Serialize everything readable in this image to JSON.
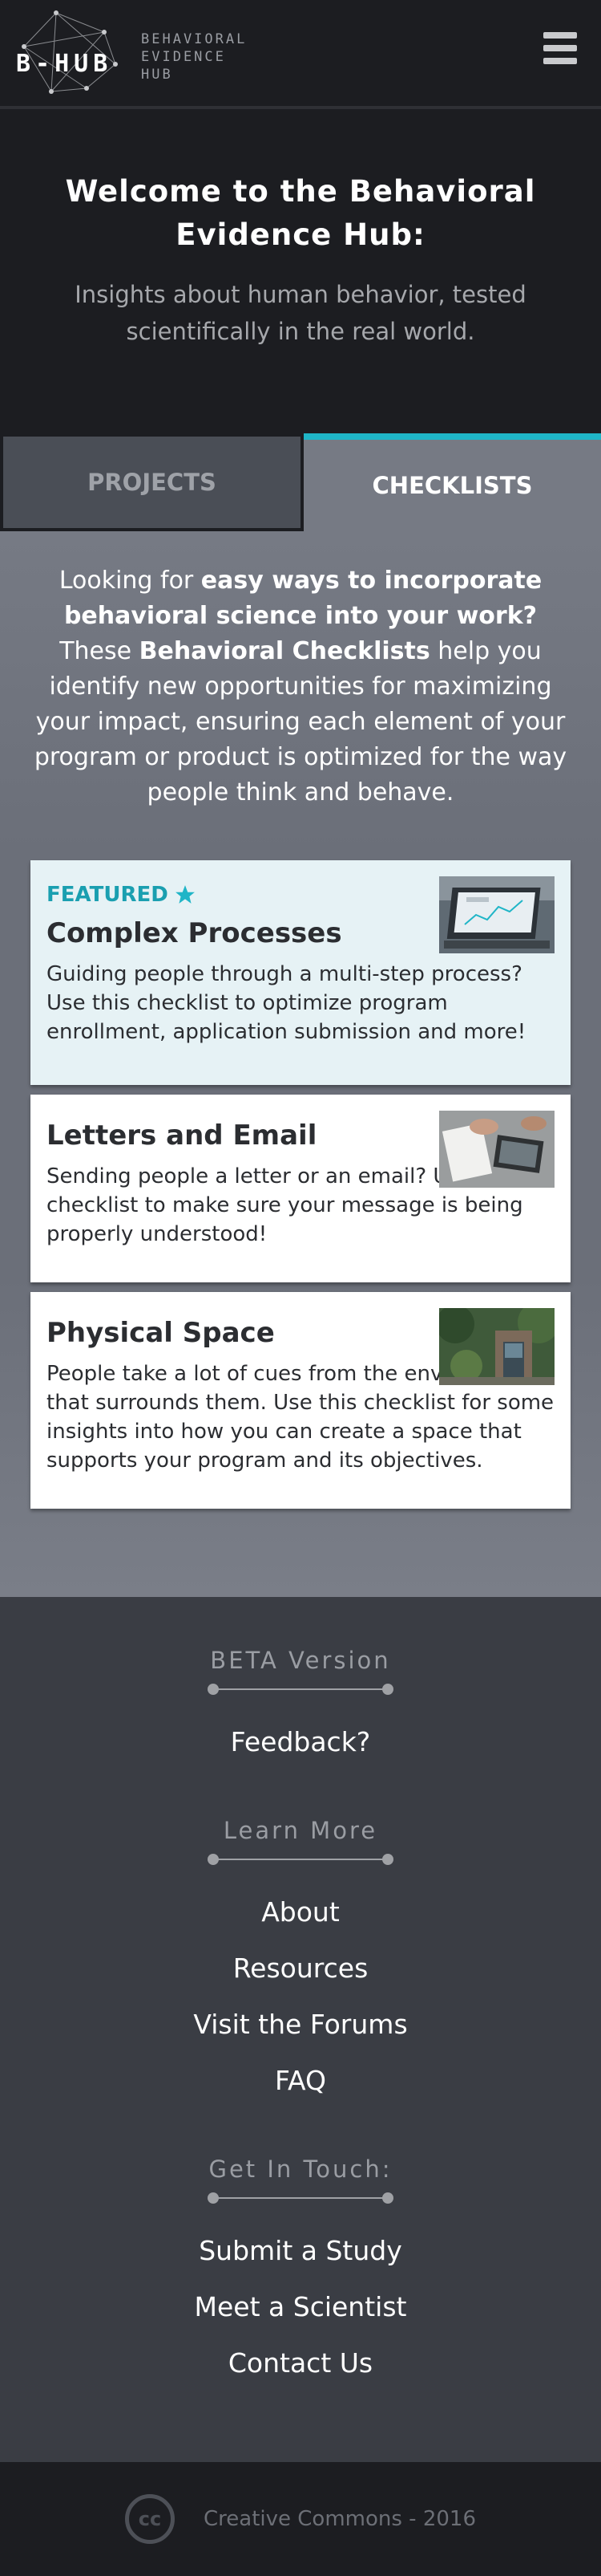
{
  "header": {
    "logo_text": "B-HUB",
    "logo_sub": [
      "BEHAVIORAL",
      "EVIDENCE",
      "HUB"
    ],
    "menu_icon": "hamburger-icon"
  },
  "hero": {
    "title": "Welcome to the Behavioral Evidence Hub:",
    "subtitle": "Insights about human behavior, tested scientifically in the real world."
  },
  "tabs": [
    {
      "label": "PROJECTS",
      "active": false
    },
    {
      "label": "CHECKLISTS",
      "active": true
    }
  ],
  "intro": {
    "p1": "Looking for ",
    "b1": "easy ways to incorporate behavioral science into your work?",
    "p2": " These ",
    "b2": "Behavioral Checklists",
    "p3": " help you identify new opportunities for maximizing your impact, ensuring each element of your program or product is optimized for the way people think and behave."
  },
  "cards": [
    {
      "featured_label": "FEATURED",
      "title": "Complex Processes",
      "desc": "Guiding people through a multi-step process? Use this checklist to optimize program enrollment, application submission and more!"
    },
    {
      "title": "Letters and Email",
      "desc": "Sending people a letter or an email? Use this checklist to make sure your message is being properly understood!"
    },
    {
      "title": "Physical Space",
      "desc": "People take a lot of cues from the environment that surrounds them. Use this checklist for some insights into how you can create a space that supports your program and its objectives."
    }
  ],
  "footer": {
    "beta": {
      "heading": "BETA Version",
      "links": [
        "Feedback?"
      ]
    },
    "learn": {
      "heading": "Learn More",
      "links": [
        "About",
        "Resources",
        "Visit the Forums",
        "FAQ"
      ]
    },
    "touch": {
      "heading": "Get In Touch:",
      "links": [
        "Submit a Study",
        "Meet a Scientist",
        "Contact Us"
      ]
    },
    "cc_icon": "cc",
    "copyright": "Creative Commons - 2016"
  },
  "colors": {
    "accent": "#1fb5c7",
    "dark": "#1c1d21",
    "footer": "#3a3d44"
  }
}
